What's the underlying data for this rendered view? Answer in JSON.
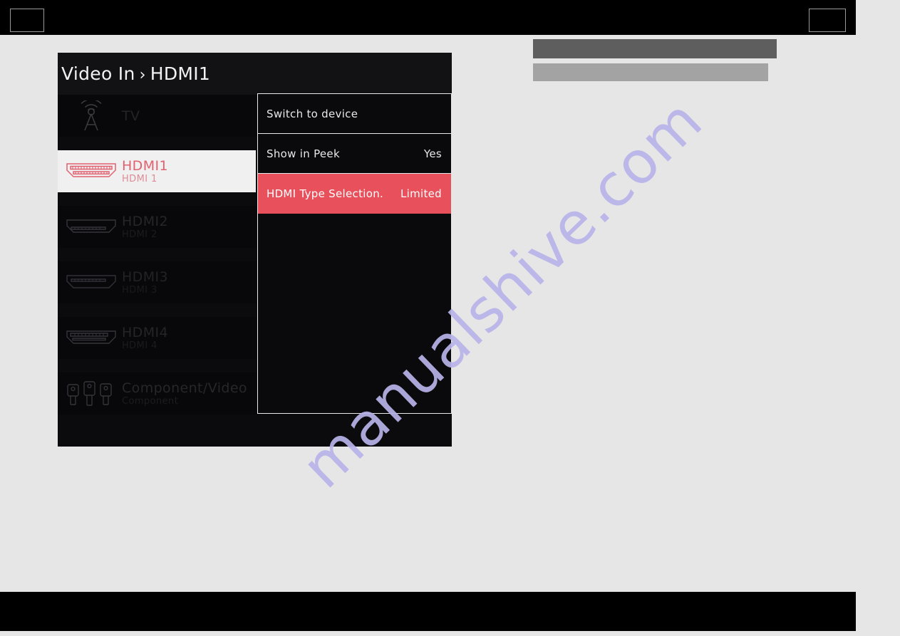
{
  "page": {
    "background_color": "#e6e6e6",
    "band_color": "#000000"
  },
  "watermark": {
    "text": "manualshive.com",
    "color": "#b8b4ea"
  },
  "osd": {
    "breadcrumb": {
      "root": "Video In",
      "separator": "›",
      "current": "HDMI1"
    },
    "accent_color": "#e8505b",
    "sources": [
      {
        "name": "TV",
        "subtitle": "",
        "icon": "antenna-icon",
        "selected": false
      },
      {
        "name": "HDMI1",
        "subtitle": "HDMI 1",
        "icon": "hdmi-connector-icon",
        "selected": true
      },
      {
        "name": "HDMI2",
        "subtitle": "HDMI 2",
        "icon": "hdmi-connector-icon",
        "selected": false
      },
      {
        "name": "HDMI3",
        "subtitle": "HDMI 3",
        "icon": "hdmi-connector-icon",
        "selected": false
      },
      {
        "name": "HDMI4",
        "subtitle": "HDMI 4",
        "icon": "hdmi-connector-icon",
        "selected": false
      },
      {
        "name": "Component/Video",
        "subtitle": "Component",
        "icon": "rca-connectors-icon",
        "selected": false
      }
    ],
    "menu": [
      {
        "label": "Switch to device",
        "value": "",
        "selected": false
      },
      {
        "label": "Show in Peek",
        "value": "Yes",
        "selected": false
      },
      {
        "label": "HDMI Type Selection.",
        "value": "Limited",
        "selected": true
      }
    ]
  },
  "redactions": [
    {
      "color": "#5e5e5e"
    },
    {
      "color": "#a3a3a3"
    }
  ]
}
